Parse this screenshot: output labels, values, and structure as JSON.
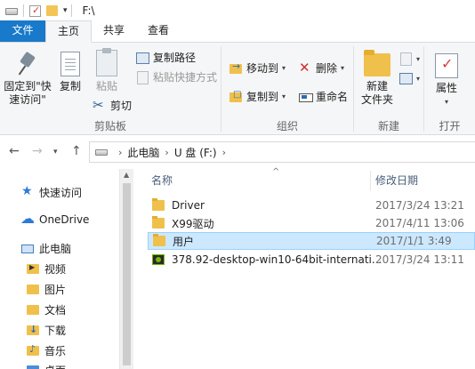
{
  "window": {
    "title": "F:\\",
    "qa_icons": [
      "drive-icon",
      "properties-icon",
      "new-folder-icon",
      "customize-caret-icon"
    ]
  },
  "tabs": [
    {
      "label": "文件",
      "state": "file"
    },
    {
      "label": "主页",
      "state": "active"
    },
    {
      "label": "共享",
      "state": "normal"
    },
    {
      "label": "查看",
      "state": "normal"
    }
  ],
  "ribbon": {
    "clipboard": {
      "group_label": "剪贴板",
      "pin_quick_access_line1": "固定到\"快",
      "pin_quick_access_line2": "速访问\"",
      "copy": "复制",
      "paste": "粘贴",
      "copy_path": "复制路径",
      "paste_shortcut": "粘贴快捷方式",
      "cut": "剪切"
    },
    "organize": {
      "group_label": "组织",
      "move_to": "移动到",
      "copy_to": "复制到",
      "delete": "删除",
      "rename": "重命名"
    },
    "new": {
      "group_label": "新建",
      "new_folder_line1": "新建",
      "new_folder_line2": "文件夹"
    },
    "open": {
      "group_label": "打开",
      "properties": "属性"
    }
  },
  "address": {
    "segments": [
      "此电脑",
      "U 盘 (F:)"
    ]
  },
  "navpane": {
    "items": [
      {
        "label": "快速访问",
        "icon": "star-icon"
      },
      {
        "label": "OneDrive",
        "icon": "cloud-icon"
      },
      {
        "label": "此电脑",
        "icon": "computer-icon"
      },
      {
        "label": "视频",
        "icon": "video-folder-icon"
      },
      {
        "label": "图片",
        "icon": "pictures-folder-icon"
      },
      {
        "label": "文档",
        "icon": "documents-folder-icon"
      },
      {
        "label": "下载",
        "icon": "downloads-folder-icon"
      },
      {
        "label": "音乐",
        "icon": "music-folder-icon"
      },
      {
        "label": "桌面",
        "icon": "desktop-folder-icon"
      }
    ]
  },
  "filelist": {
    "columns": {
      "name": "名称",
      "modified": "修改日期"
    },
    "rows": [
      {
        "name": "Driver",
        "date": "2017/3/24 13:21",
        "type": "folder",
        "selected": false
      },
      {
        "name": "X99驱动",
        "date": "2017/4/11 13:06",
        "type": "folder",
        "selected": false
      },
      {
        "name": "用户",
        "date": "2017/1/1 3:49",
        "type": "folder",
        "selected": true
      },
      {
        "name": "378.92-desktop-win10-64bit-internati...",
        "date": "2017/3/24 13:11",
        "type": "exe",
        "selected": false
      }
    ]
  },
  "colors": {
    "file_tab": "#1979ca",
    "selection": "#cce8ff",
    "folder": "#f0c04c"
  }
}
